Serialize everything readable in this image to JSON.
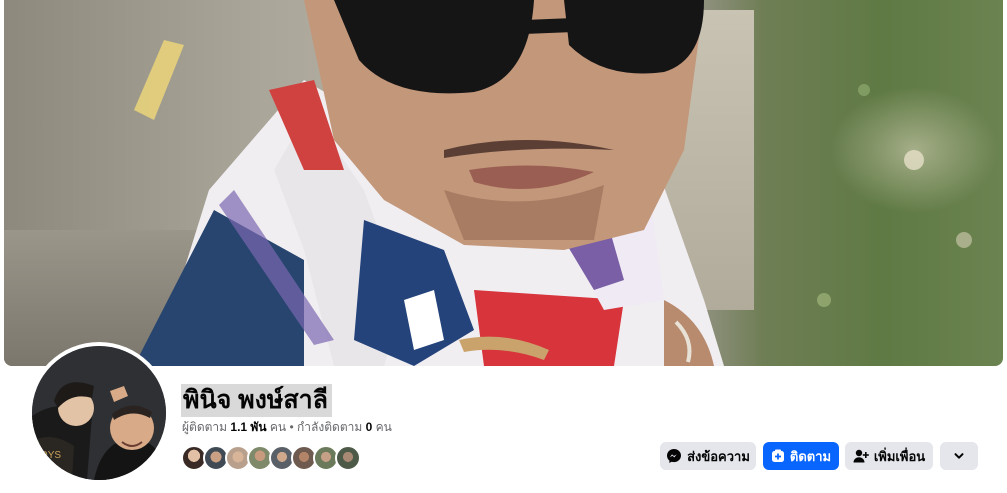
{
  "profile": {
    "name": "พินิจ พงษ์สาลี",
    "followers_label": "ผู้ติดตาม",
    "followers_count": "1.1 พัน",
    "followers_unit": "คน",
    "separator": "•",
    "following_label": "กำลังติดตาม",
    "following_count": "0",
    "following_unit": "คน"
  },
  "actions": {
    "message_label": "ส่งข้อความ",
    "follow_label": "ติดตาม",
    "add_friend_label": "เพิ่มเพื่อน"
  },
  "icons": {
    "message": "messenger-icon",
    "follow": "follow-icon",
    "add_friend": "add-friend-icon",
    "more": "chevron-down-icon"
  },
  "colors": {
    "primary": "#0866ff",
    "secondary_button": "#e4e6eb",
    "muted_text": "#65676b",
    "name_highlight": "#d9d9d9"
  },
  "friend_avatars": [
    "friend-1",
    "friend-2",
    "friend-3",
    "friend-4",
    "friend-5",
    "friend-6",
    "friend-7",
    "friend-8"
  ]
}
